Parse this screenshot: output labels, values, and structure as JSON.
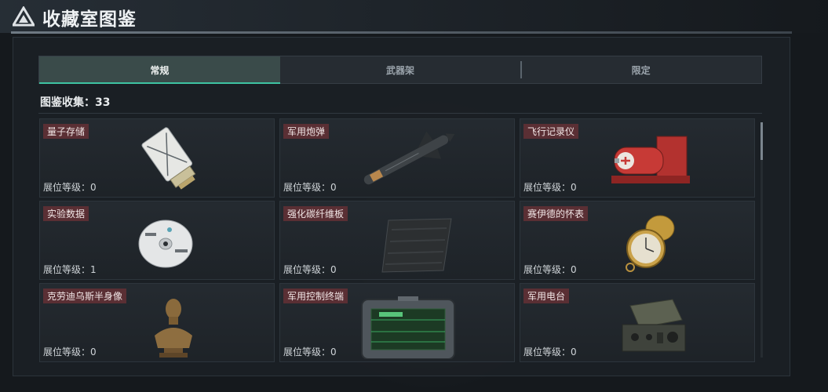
{
  "header": {
    "title": "收藏室图鉴",
    "logo_icon": "triangle-logo-icon"
  },
  "tabs": [
    {
      "label": "常规",
      "active": true
    },
    {
      "label": "武器架",
      "active": false
    },
    {
      "label": "限定",
      "active": false
    }
  ],
  "collection": {
    "label": "图鉴收集：",
    "count": "33"
  },
  "items": [
    {
      "name": "量子存储",
      "level": "展位等级：0",
      "icon": "usb-drive-icon"
    },
    {
      "name": "军用炮弹",
      "level": "展位等级：0",
      "icon": "missile-shell-icon"
    },
    {
      "name": "飞行记录仪",
      "level": "展位等级：0",
      "icon": "flight-recorder-icon"
    },
    {
      "name": "实验数据",
      "level": "展位等级：1",
      "icon": "disc-icon"
    },
    {
      "name": "强化碳纤维板",
      "level": "展位等级：0",
      "icon": "carbon-fiber-plate-icon"
    },
    {
      "name": "赛伊德的怀表",
      "level": "展位等级：0",
      "icon": "pocket-watch-icon"
    },
    {
      "name": "克劳迪乌斯半身像",
      "level": "展位等级：0",
      "icon": "bust-statue-icon"
    },
    {
      "name": "军用控制终端",
      "level": "展位等级：0",
      "icon": "control-terminal-icon"
    },
    {
      "name": "军用电台",
      "level": "展位等级：0",
      "icon": "military-radio-icon"
    }
  ],
  "colors": {
    "accent": "#3ec3a2",
    "name_tag": "#5a2f34",
    "active_tab": "#3a4b4a"
  }
}
